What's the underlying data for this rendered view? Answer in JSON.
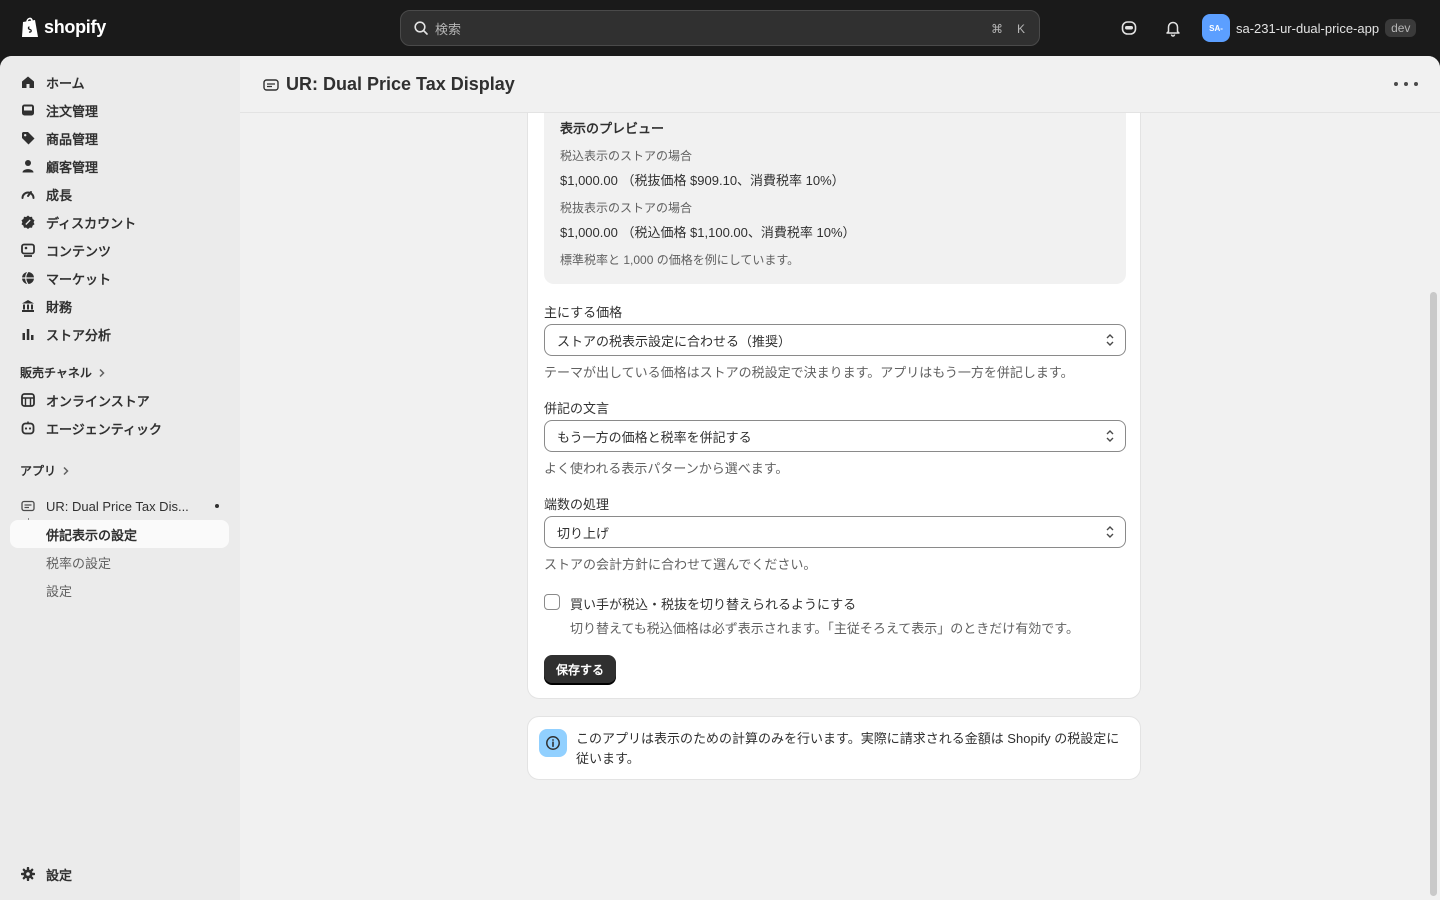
{
  "topbar": {
    "brand": "shopify",
    "search_placeholder": "検索",
    "shortcut_key1": "⌘",
    "shortcut_key2": "K",
    "avatar_initials": "SA-",
    "store_name": "sa-231-ur-dual-price-app",
    "badge": "dev"
  },
  "sidebar": {
    "items": [
      {
        "label": "ホーム",
        "icon": "home-icon"
      },
      {
        "label": "注文管理",
        "icon": "inbox-icon"
      },
      {
        "label": "商品管理",
        "icon": "tag-icon"
      },
      {
        "label": "顧客管理",
        "icon": "person-icon"
      },
      {
        "label": "成長",
        "icon": "gauge-icon"
      },
      {
        "label": "ディスカウント",
        "icon": "discount-icon"
      },
      {
        "label": "コンテンツ",
        "icon": "content-icon"
      },
      {
        "label": "マーケット",
        "icon": "globe-icon"
      },
      {
        "label": "財務",
        "icon": "bank-icon"
      },
      {
        "label": "ストア分析",
        "icon": "chart-icon"
      }
    ],
    "sales_channels_label": "販売チャネル",
    "channels": [
      {
        "label": "オンラインストア",
        "icon": "store-icon"
      },
      {
        "label": "エージェンティック",
        "icon": "agent-icon"
      }
    ],
    "apps_label": "アプリ",
    "app_name": "UR: Dual Price Tax Dis...",
    "app_subitems": [
      "併記表示の設定",
      "税率の設定",
      "設定"
    ],
    "settings_label": "設定"
  },
  "page": {
    "title": "UR: Dual Price Tax Display"
  },
  "preview": {
    "title": "表示のプレビュー",
    "incl_label": "税込表示のストアの場合",
    "incl_value": "$1,000.00 （税抜価格 $909.10、消費税率 10%）",
    "excl_label": "税抜表示のストアの場合",
    "excl_value": "$1,000.00 （税込価格 $1,100.00、消費税率 10%）",
    "note": "標準税率と 1,000 の価格を例にしています。"
  },
  "form": {
    "primary_price_label": "主にする価格",
    "primary_price_value": "ストアの税表示設定に合わせる（推奨）",
    "primary_price_help": "テーマが出している価格はストアの税設定で決まります。アプリはもう一方を併記します。",
    "wording_label": "併記の文言",
    "wording_value": "もう一方の価格と税率を併記する",
    "wording_help": "よく使われる表示パターンから選べます。",
    "rounding_label": "端数の処理",
    "rounding_value": "切り上げ",
    "rounding_help": "ストアの会計方針に合わせて選んでください。",
    "toggle_label": "買い手が税込・税抜を切り替えられるようにする",
    "toggle_checked": false,
    "toggle_help": "切り替えても税込価格は必ず表示されます。「主従そろえて表示」のときだけ有効です。",
    "save_label": "保存する"
  },
  "banner": {
    "text": "このアプリは表示のための計算のみを行います。実際に請求される金額は Shopify の税設定に従います。"
  },
  "colors": {
    "topbar_bg": "#1a1a1a",
    "primary_button": "#303030",
    "info_icon_bg": "#91d0ff",
    "avatar_bg": "#5c9fff"
  }
}
